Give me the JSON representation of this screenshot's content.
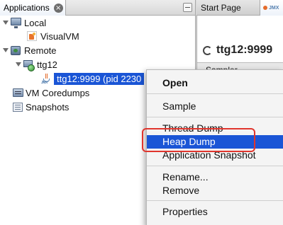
{
  "applications_panel": {
    "tab_label": "Applications",
    "tree": {
      "local": "Local",
      "visualvm": "VisualVM",
      "remote": "Remote",
      "host": "ttg12",
      "jmx_connection": "ttg12:9999 (pid 2230",
      "coredumps": "VM Coredumps",
      "snapshots": "Snapshots"
    }
  },
  "editor": {
    "tabs": [
      "Start Page"
    ],
    "header_title": "ttg12:9999",
    "subtab": "Sampler"
  },
  "context_menu": {
    "items": [
      "Open",
      "Sample",
      "Thread Dump",
      "Heap Dump",
      "Application Snapshot",
      "Rename...",
      "Remove",
      "Properties"
    ],
    "highlighted": "Heap Dump"
  },
  "colors": {
    "selection": "#1a55d6",
    "annotation_box": "#e0352d"
  },
  "icons": {
    "close_tab": "close-circle-icon",
    "panel_minimize": "minimize-icon",
    "local": "computer-icon",
    "visualvm": "visualvm-app-icon",
    "remote": "remote-hosts-icon",
    "host": "host-globe-icon",
    "jmx": "java-jmx-icon",
    "coredumps": "coredump-icon",
    "snapshots": "snapshots-icon",
    "loading": "spinner-icon"
  }
}
